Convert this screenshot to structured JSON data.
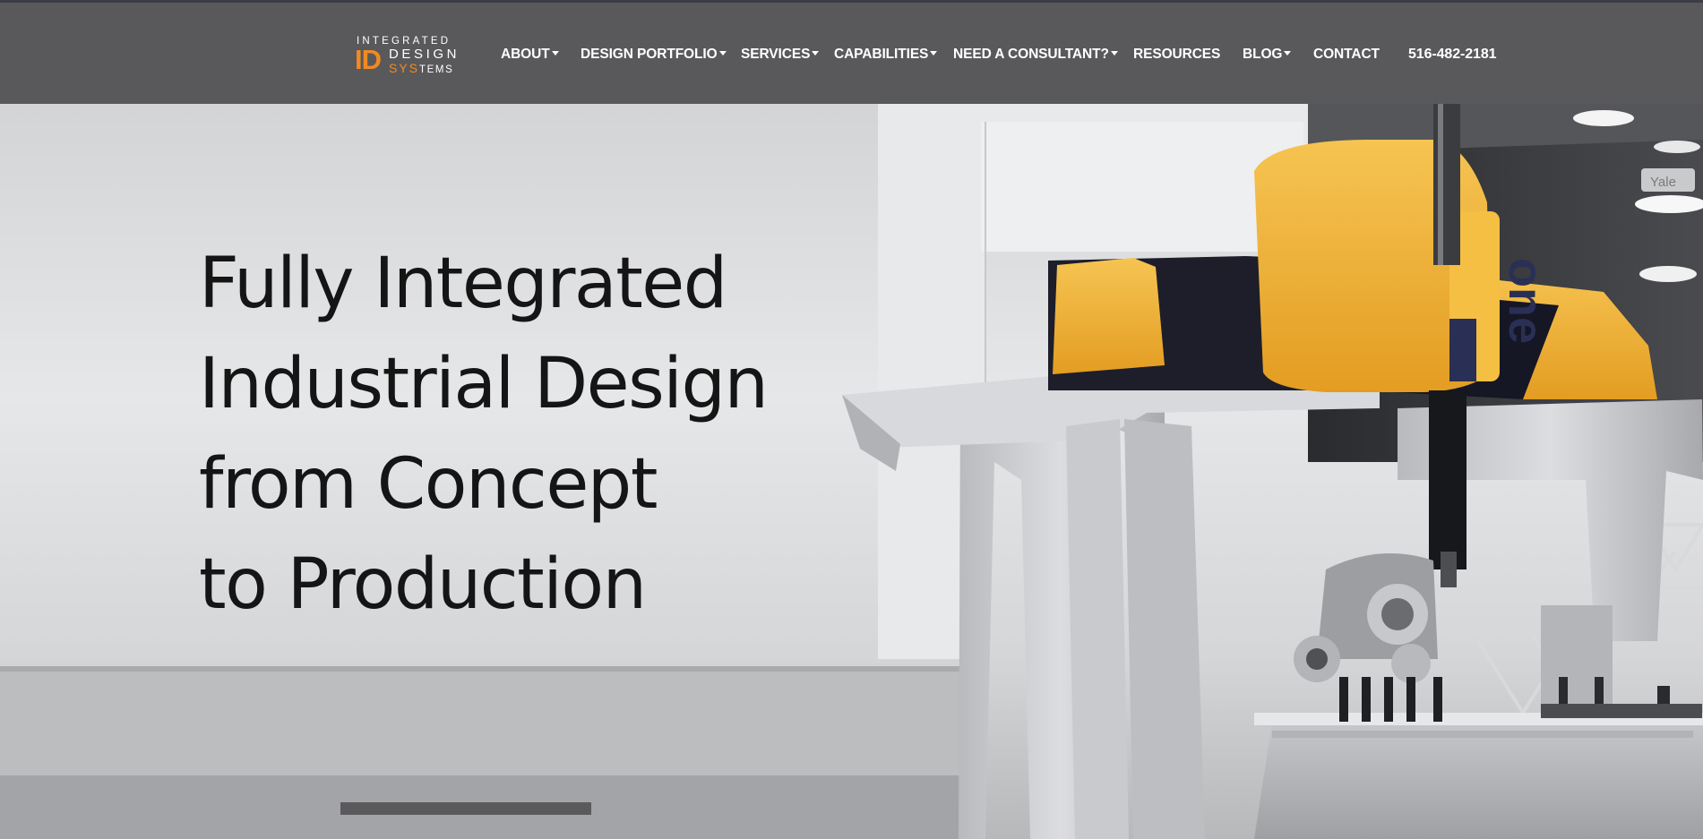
{
  "brand": {
    "line1": "INTEGRATED",
    "id": "ID",
    "line2": "DESIGN",
    "line3_accent": "SYS",
    "line3_rest": "TEMS"
  },
  "nav": {
    "items": [
      {
        "label": "ABOUT"
      },
      {
        "label": "DESIGN PORTFOLIO"
      },
      {
        "label": "SERVICES"
      },
      {
        "label": "CAPABILITIES"
      },
      {
        "label": "NEED A CONSULTANT?"
      },
      {
        "label": "RESOURCES"
      },
      {
        "label": "BLOG"
      },
      {
        "label": "CONTACT"
      }
    ],
    "phone": "516-482-2181"
  },
  "hero": {
    "lines": [
      "Fully Integrated",
      "Industrial Design",
      "from Concept",
      "to Production"
    ],
    "machine_badge": "one",
    "sign_text": "Yale"
  },
  "colors": {
    "header_bg": "#59595b",
    "accent_orange": "#f08a24",
    "machine_yellow": "#f2b43a"
  }
}
